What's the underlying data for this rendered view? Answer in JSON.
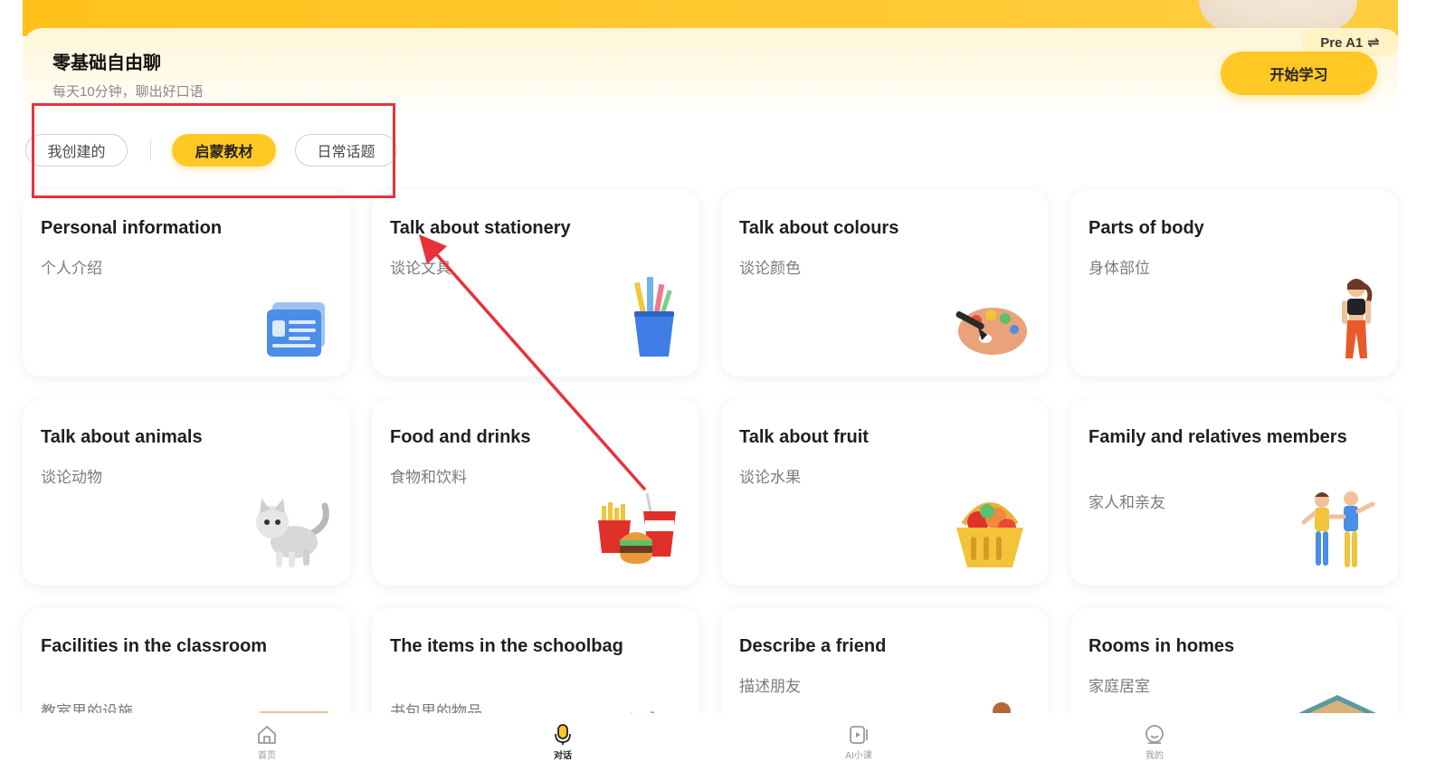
{
  "banner": {
    "title": "零基础自由聊",
    "subtitle": "每天10分钟，聊出好口语",
    "level_chip": "Pre A1",
    "level_swap_icon": "⇌",
    "start_button": "开始学习"
  },
  "filters": [
    {
      "label": "我创建的",
      "active": false
    },
    {
      "label": "启蒙教材",
      "active": true
    },
    {
      "label": "日常话题",
      "active": false
    }
  ],
  "cards": [
    {
      "title": "Personal information",
      "subtitle": "个人介绍",
      "icon": "id-card-icon"
    },
    {
      "title": "Talk about stationery",
      "subtitle": "谈论文具",
      "icon": "pencil-cup-icon"
    },
    {
      "title": "Talk about colours",
      "subtitle": "谈论颜色",
      "icon": "paint-palette-icon"
    },
    {
      "title": "Parts of body",
      "subtitle": "身体部位",
      "icon": "person-icon"
    },
    {
      "title": "Talk about animals",
      "subtitle": "谈论动物",
      "icon": "cat-icon"
    },
    {
      "title": "Food and drinks",
      "subtitle": "食物和饮料",
      "icon": "burger-fries-icon"
    },
    {
      "title": "Talk about fruit",
      "subtitle": "谈论水果",
      "icon": "fruit-basket-icon"
    },
    {
      "title": "Family and relatives members",
      "subtitle": "家人和亲友",
      "icon": "family-icon"
    },
    {
      "title": "Facilities in the classroom",
      "subtitle": "教室里的设施",
      "icon": "classroom-icon"
    },
    {
      "title": "The items in the schoolbag",
      "subtitle": "书包里的物品",
      "icon": "schoolbag-icon"
    },
    {
      "title": "Describe a friend",
      "subtitle": "描述朋友",
      "icon": "friend-icon"
    },
    {
      "title": "Rooms in homes",
      "subtitle": "家庭居室",
      "icon": "house-icon"
    }
  ],
  "nav": [
    {
      "label": "首页",
      "icon": "home-icon",
      "active": false
    },
    {
      "label": "对话",
      "icon": "microphone-icon",
      "active": true
    },
    {
      "label": "AI小课",
      "icon": "video-lesson-icon",
      "active": false
    },
    {
      "label": "我的",
      "icon": "profile-icon",
      "active": false
    }
  ],
  "colors": {
    "accent": "#ffc824",
    "annotation": "#e8323a"
  }
}
